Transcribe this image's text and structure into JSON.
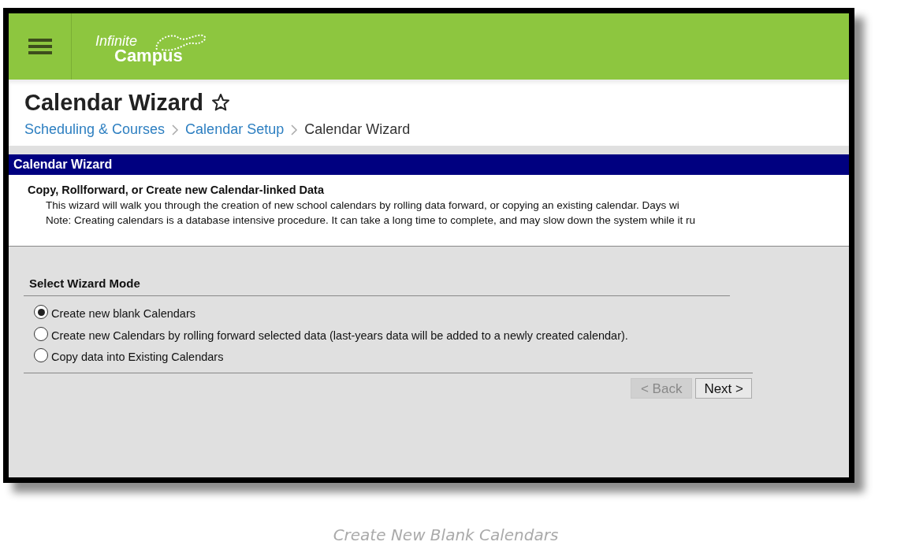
{
  "header": {
    "logo": [
      "Infinite",
      "Campus"
    ]
  },
  "page": {
    "title": "Calendar Wizard",
    "favorite": false,
    "breadcrumb": [
      {
        "label": "Scheduling & Courses",
        "link": true
      },
      {
        "label": "Calendar Setup",
        "link": true
      },
      {
        "label": "Calendar Wizard",
        "link": false
      }
    ]
  },
  "panel": {
    "title": "Calendar Wizard",
    "heading": "Copy, Rollforward, or Create new Calendar-linked Data",
    "description": [
      "This wizard will walk you through the creation of new school calendars by rolling data forward, or copying an existing calendar. Days wi",
      "Note: Creating calendars is a database intensive procedure. It can take a long time to complete, and may slow down the system while it ru"
    ]
  },
  "mode": {
    "title": "Select Wizard Mode",
    "options": [
      {
        "label": "Create new blank Calendars",
        "selected": true
      },
      {
        "label": "Create new Calendars by rolling forward selected data (last-years data will be added to a newly created calendar).",
        "selected": false
      },
      {
        "label": "Copy data into Existing Calendars",
        "selected": false
      }
    ]
  },
  "buttons": [
    {
      "label": "< Back",
      "disabled": true
    },
    {
      "label": "Next >",
      "disabled": false
    }
  ],
  "caption": "Create New Blank Calendars"
}
